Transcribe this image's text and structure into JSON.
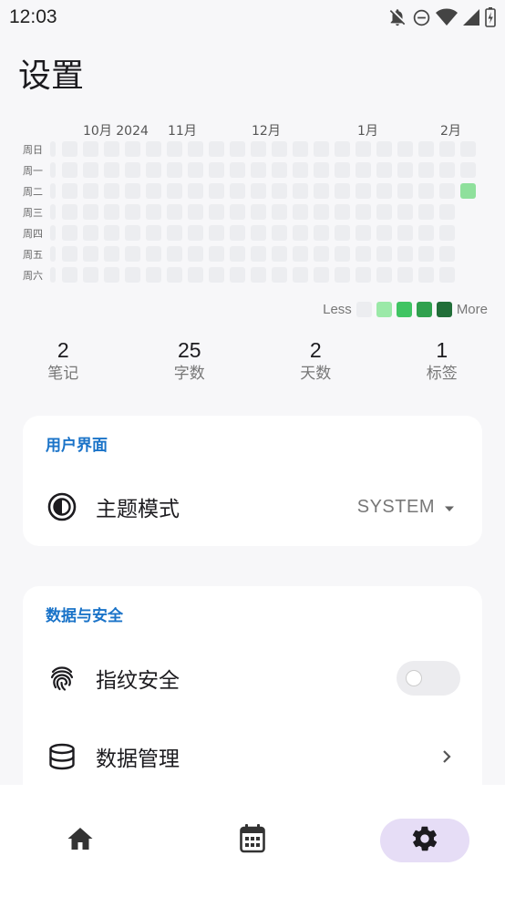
{
  "status_bar": {
    "time": "12:03",
    "icons": [
      "notifications-off-icon",
      "do-not-disturb-icon",
      "wifi-icon",
      "cellular-signal-icon",
      "battery-icon"
    ]
  },
  "page_title": "设置",
  "heatmap": {
    "months": [
      "10月 2024",
      "11月",
      "12月",
      "1月",
      "2月"
    ],
    "weekdays": [
      "周日",
      "周一",
      "周二",
      "周三",
      "周四",
      "周五",
      "周六"
    ],
    "week_columns": 20,
    "active_days": [
      {
        "week": 19,
        "weekday": 2,
        "level": 1
      }
    ],
    "legend": {
      "less": "Less",
      "more": "More",
      "colors": [
        "#ecedf0",
        "#9be9a8",
        "#40c463",
        "#30a14e",
        "#216e39"
      ]
    },
    "active_color": "#8fe09c"
  },
  "stats": [
    {
      "value": "2",
      "label": "笔记"
    },
    {
      "value": "25",
      "label": "字数"
    },
    {
      "value": "2",
      "label": "天数"
    },
    {
      "value": "1",
      "label": "标签"
    }
  ],
  "sections": {
    "ui": {
      "title": "用户界面",
      "theme": {
        "label": "主题模式",
        "value": "SYSTEM",
        "icon": "contrast-icon"
      }
    },
    "data_security": {
      "title": "数据与安全",
      "fingerprint": {
        "label": "指纹安全",
        "enabled": false,
        "icon": "fingerprint-icon"
      },
      "data_management": {
        "label": "数据管理",
        "icon": "database-icon"
      }
    }
  },
  "bottom_nav": {
    "items": [
      {
        "name": "home",
        "icon": "home-icon",
        "active": false
      },
      {
        "name": "calendar",
        "icon": "calendar-icon",
        "active": false
      },
      {
        "name": "settings",
        "icon": "gear-icon",
        "active": true
      }
    ]
  },
  "colors": {
    "accent": "#1a73c8",
    "nav_active_bg": "#e6ddf6",
    "background": "#f7f7f9"
  }
}
